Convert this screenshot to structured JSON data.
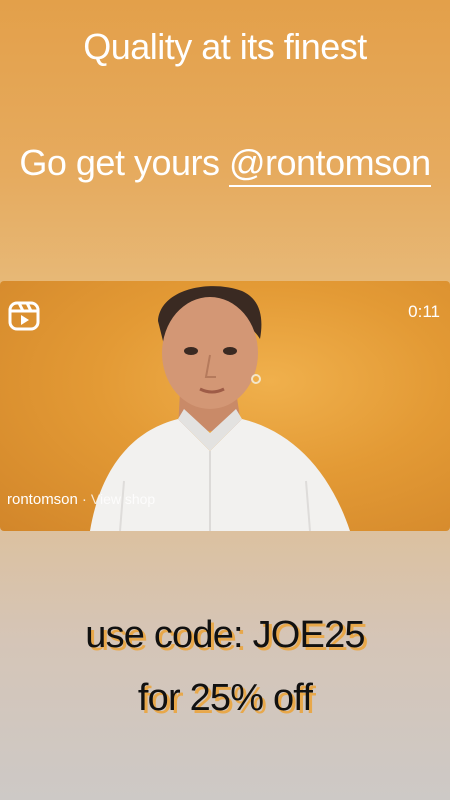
{
  "story": {
    "headline": "Quality at its finest",
    "subline_prefix": "Go get yours ",
    "mention": "@rontomson"
  },
  "reel": {
    "icon": "reels-icon",
    "duration": "0:11",
    "username": "rontomson",
    "separator": "·",
    "view_shop": "View shop"
  },
  "promo": {
    "line1": "use code: JOE25",
    "line2": "for 25% off"
  },
  "colors": {
    "background_top": "#e3a04a",
    "background_bottom": "#cdc9c6",
    "promo_shadow": "#e8a84a"
  }
}
